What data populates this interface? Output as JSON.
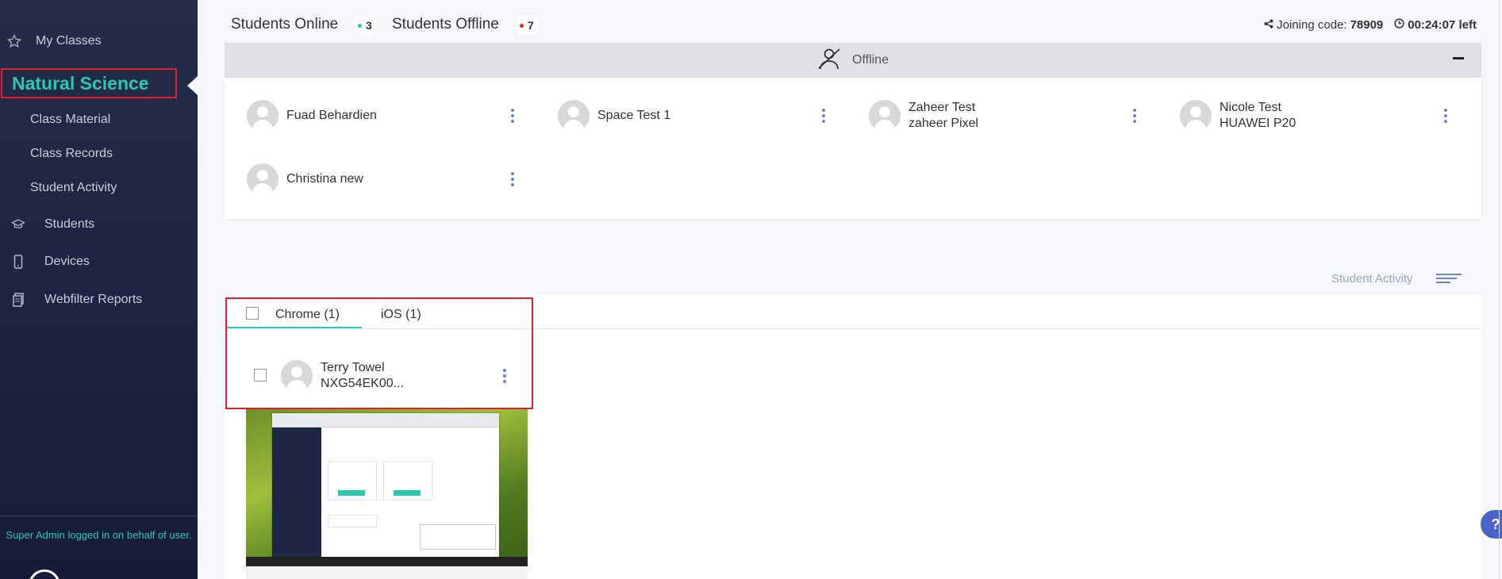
{
  "sidebar": {
    "my_classes": "My Classes",
    "active_class": "Natural Science",
    "sub_items": [
      "Class Material",
      "Class Records",
      "Student Activity"
    ],
    "students": "Students",
    "devices": "Devices",
    "webfilter": "Webfilter Reports",
    "admin_note": "Super Admin logged in on behalf of user."
  },
  "header": {
    "online_label": "Students Online",
    "online_count": "3",
    "offline_label": "Students Offline",
    "offline_count": "7",
    "joining_label": "Joining code:",
    "joining_code": "78909",
    "time_left": "00:24:07 left"
  },
  "offline_panel": {
    "title": "Offline",
    "students": [
      {
        "name": "Fuad Behardien",
        "device": ""
      },
      {
        "name": "Space Test 1",
        "device": ""
      },
      {
        "name": "Zaheer Test",
        "device": "zaheer Pixel"
      },
      {
        "name": "Nicole Test",
        "device": "HUAWEI P20"
      },
      {
        "name": "Christina new",
        "device": ""
      }
    ]
  },
  "activity": {
    "label": "Student Activity",
    "tabs": [
      "Chrome (1)",
      "iOS (1)"
    ],
    "student": {
      "name": "Terry Towel",
      "device": "NXG54EK00..."
    }
  },
  "colors": {
    "accent": "#28c8b4",
    "highlight": "#e0202e",
    "sidebar_bg": "#1f2545",
    "online_dot": "#28c8b4",
    "offline_dot": "#e0202e"
  },
  "icons": {
    "my_classes": "star-icon",
    "students": "graduation-cap-icon",
    "devices": "phone-icon",
    "webfilter": "report-icon",
    "offline": "user-offline-icon",
    "share": "share-icon",
    "clock": "clock-icon",
    "help": "help-icon"
  },
  "help_glyph": "?"
}
